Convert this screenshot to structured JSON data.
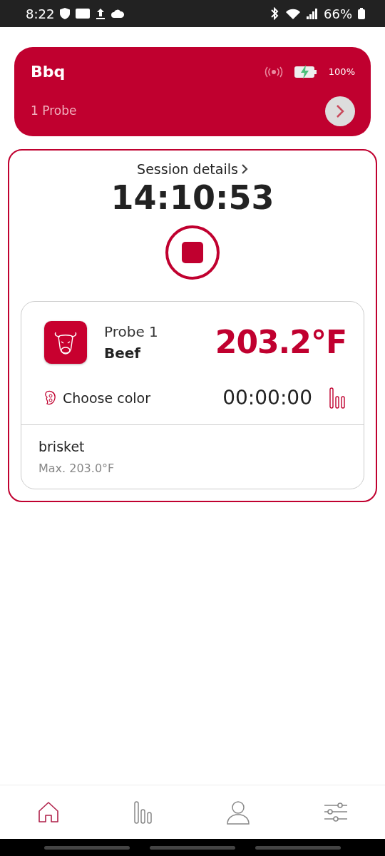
{
  "status_bar": {
    "time": "8:22",
    "battery": "66%"
  },
  "device": {
    "name": "Bbq",
    "battery": "100%",
    "probes": "1 Probe"
  },
  "session": {
    "link": "Session details",
    "elapsed": "14:10:53"
  },
  "probes": [
    {
      "name": "Probe 1",
      "meat": "Beef",
      "temperature": "203.2°F",
      "color_label": "Choose color",
      "timer": "00:00:00",
      "cut": "brisket",
      "max": "Max. 203.0°F"
    }
  ],
  "nav": [
    {
      "kind": "home",
      "selected": true
    },
    {
      "kind": "stats",
      "selected": false
    },
    {
      "kind": "profile",
      "selected": false
    },
    {
      "kind": "settings",
      "selected": false
    }
  ]
}
